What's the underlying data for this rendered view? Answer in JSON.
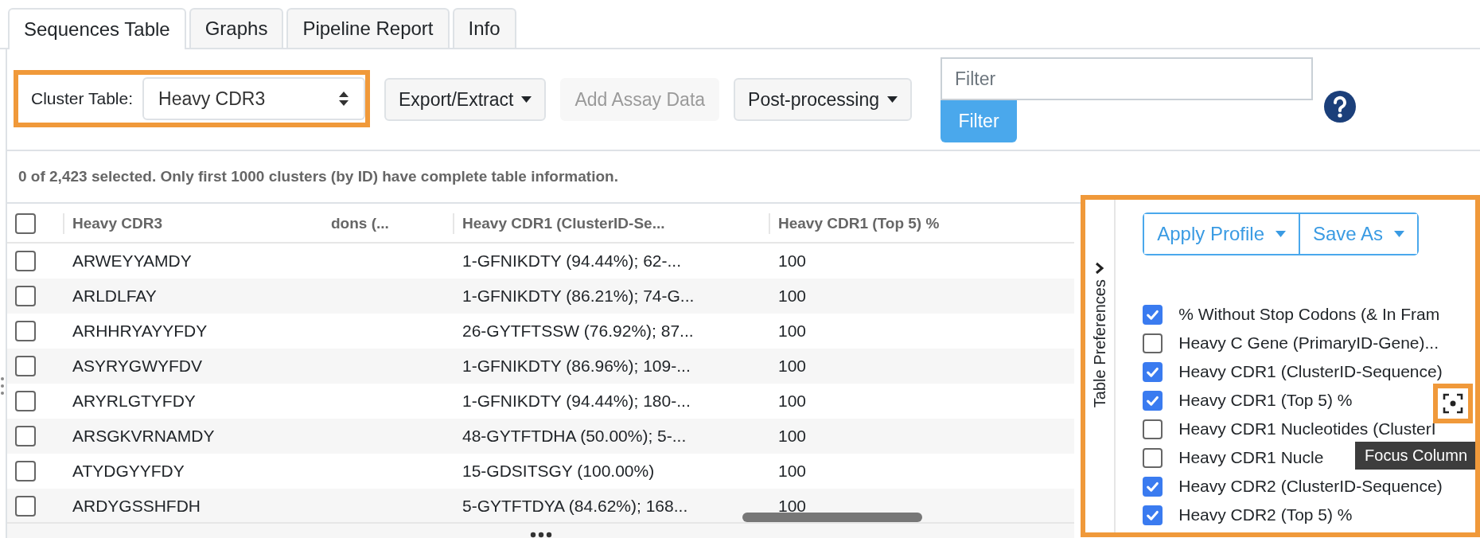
{
  "tabs": [
    {
      "label": "Sequences Table",
      "selected": true
    },
    {
      "label": "Graphs",
      "selected": false
    },
    {
      "label": "Pipeline Report",
      "selected": false
    },
    {
      "label": "Info",
      "selected": false
    }
  ],
  "toolbar": {
    "cluster_table": {
      "label": "Cluster Table:",
      "value": "Heavy CDR3"
    },
    "buttons": [
      {
        "label": "Export/Extract",
        "kind": "dropdown",
        "disabled": false
      },
      {
        "label": "Add Assay Data",
        "kind": "plain",
        "disabled": true
      },
      {
        "label": "Post-processing",
        "kind": "dropdown",
        "disabled": false
      }
    ],
    "filter": {
      "placeholder": "Filter",
      "button": "Filter"
    }
  },
  "selection_info": "0 of 2,423 selected. Only first 1000 clusters (by ID) have complete table information.",
  "table": {
    "header_checked": false,
    "columns": [
      "Heavy CDR3",
      "dons (...",
      "Heavy CDR1 (ClusterID-Se...",
      "Heavy CDR1 (Top 5) %"
    ],
    "rows": [
      {
        "checked": false,
        "heavy_cdr3": "ARWEYYAMDY",
        "heavy_cdr1": "1-GFNIKDTY (94.44%); 62-...",
        "heavy_cdr1_top5": "100"
      },
      {
        "checked": false,
        "heavy_cdr3": "ARLDLFAY",
        "heavy_cdr1": "1-GFNIKDTY (86.21%); 74-G...",
        "heavy_cdr1_top5": "100"
      },
      {
        "checked": false,
        "heavy_cdr3": "ARHHRYAYYFDY",
        "heavy_cdr1": "26-GYTFTSSW (76.92%); 87...",
        "heavy_cdr1_top5": "100"
      },
      {
        "checked": false,
        "heavy_cdr3": "ASYRYGWYFDV",
        "heavy_cdr1": "1-GFNIKDTY (86.96%); 109-...",
        "heavy_cdr1_top5": "100"
      },
      {
        "checked": false,
        "heavy_cdr3": "ARYRLGTYFDY",
        "heavy_cdr1": "1-GFNIKDTY (94.44%); 180-...",
        "heavy_cdr1_top5": "100"
      },
      {
        "checked": false,
        "heavy_cdr3": "ARSGKVRNAMDY",
        "heavy_cdr1": "48-GYTFTDHA (50.00%); 5-...",
        "heavy_cdr1_top5": "100"
      },
      {
        "checked": false,
        "heavy_cdr3": "ATYDGYYFDY",
        "heavy_cdr1": "15-GDSITSGY (100.00%)",
        "heavy_cdr1_top5": "100"
      },
      {
        "checked": false,
        "heavy_cdr3": "ARDYGSSHFDH",
        "heavy_cdr1": "5-GYTFTDYA (84.62%); 168...",
        "heavy_cdr1_top5": "100"
      }
    ]
  },
  "table_preferences": {
    "title": "Table Preferences",
    "profile_buttons": [
      "Apply Profile",
      "Save As"
    ],
    "columns": [
      {
        "label": "% Without Stop Codons (& In Fram",
        "checked": true
      },
      {
        "label": "Heavy C Gene (PrimaryID-Gene)...",
        "checked": false
      },
      {
        "label": "Heavy CDR1 (ClusterID-Sequence)",
        "checked": true
      },
      {
        "label": "Heavy CDR1 (Top 5) %",
        "checked": true,
        "focus_icon": true
      },
      {
        "label": "Heavy CDR1 Nucleotides (ClusterI",
        "checked": false
      },
      {
        "label": "Heavy CDR1 Nucle",
        "checked": false
      },
      {
        "label": "Heavy CDR2 (ClusterID-Sequence)",
        "checked": true
      },
      {
        "label": "Heavy CDR2 (Top 5) %",
        "checked": true
      }
    ],
    "tooltip": "Focus Column"
  }
}
